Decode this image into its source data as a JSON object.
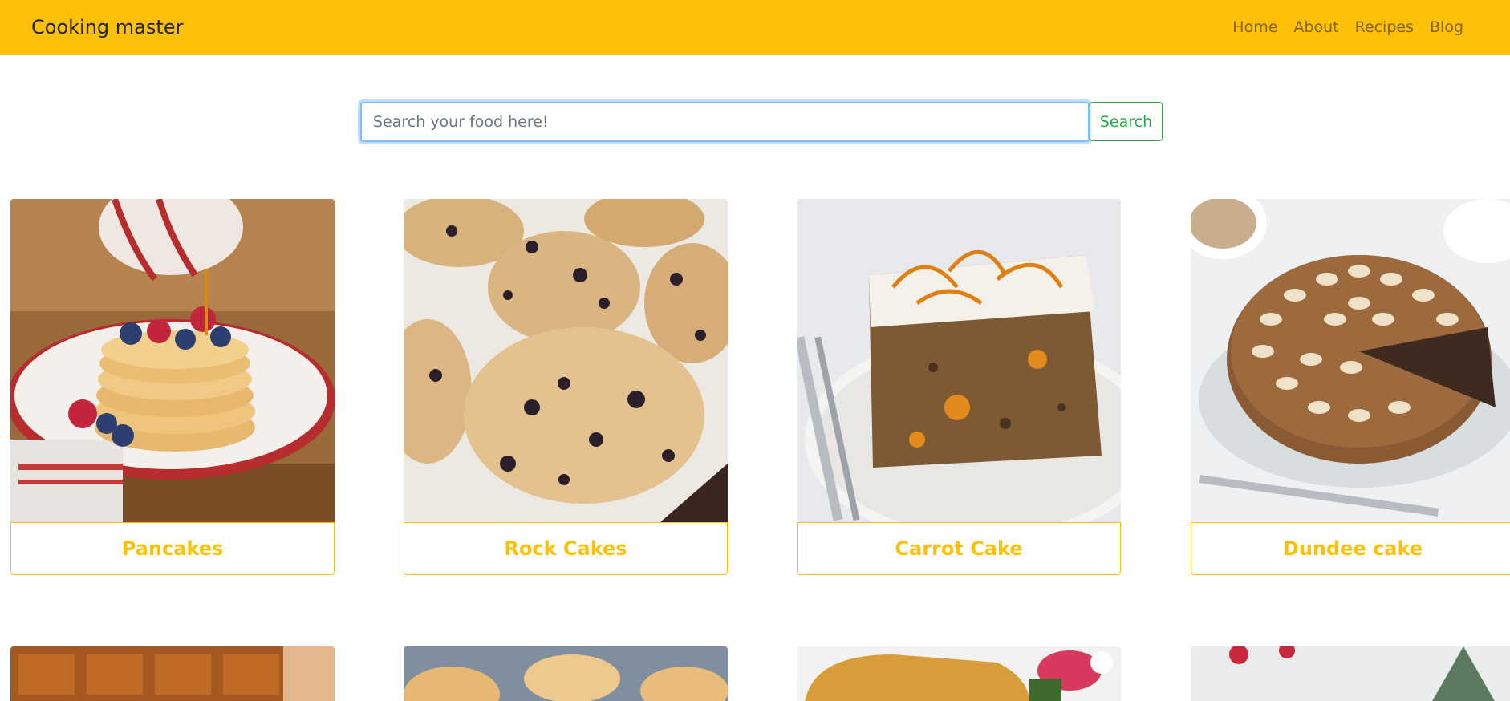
{
  "navbar": {
    "brand": "Cooking master",
    "links": [
      "Home",
      "About",
      "Recipes",
      "Blog"
    ]
  },
  "search": {
    "placeholder": "Search your food here!",
    "button_label": "Search"
  },
  "recipes": [
    {
      "title": "Pancakes"
    },
    {
      "title": "Rock Cakes"
    },
    {
      "title": "Carrot Cake"
    },
    {
      "title": "Dundee cake"
    }
  ],
  "colors": {
    "navbar_bg": "#ffc107",
    "accent": "#ffc107",
    "search_button": "#28a745",
    "focus_ring": "#80bdff"
  }
}
